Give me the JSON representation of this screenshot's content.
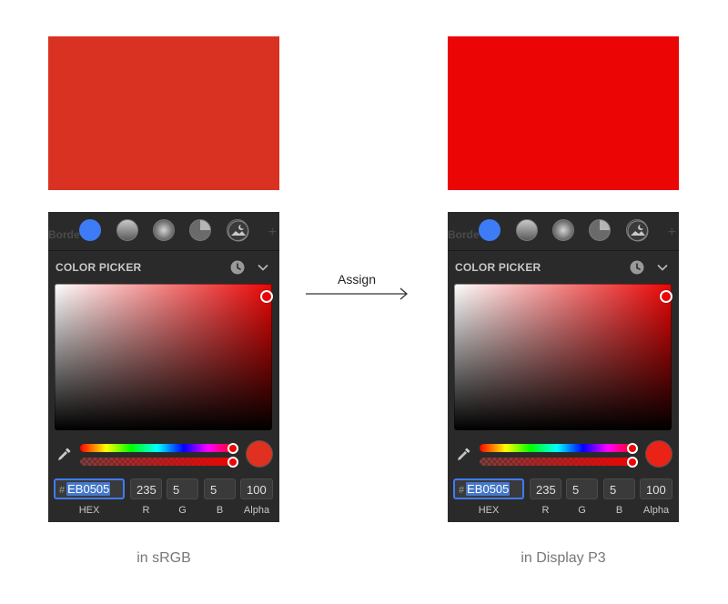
{
  "colors": {
    "srgb_swatch": "#D93223",
    "p3_swatch": "#EB0505",
    "accent": "#3D7CF6"
  },
  "arrow_label": "Assign",
  "panels": [
    {
      "id": "srgb",
      "caption": "in sRGB",
      "ghost_text": "Borde",
      "section_title": "COLOR PICKER",
      "hex_prefix": "#",
      "hex": "EB0505",
      "r": "235",
      "g": "5",
      "b": "5",
      "alpha": "100",
      "labels": {
        "hex": "HEX",
        "r": "R",
        "g": "G",
        "b": "B",
        "alpha": "Alpha"
      },
      "alpha_percent": 100,
      "icons": [
        "solid-fill-icon",
        "linear-gradient-icon",
        "radial-gradient-icon",
        "angular-gradient-icon",
        "image-fill-icon",
        "history-icon",
        "chevron-down-icon",
        "eyedropper-icon"
      ]
    },
    {
      "id": "p3",
      "caption": "in Display P3",
      "ghost_text": "Borde",
      "section_title": "COLOR PICKER",
      "hex_prefix": "#",
      "hex": "EB0505",
      "r": "235",
      "g": "5",
      "b": "5",
      "alpha": "100",
      "labels": {
        "hex": "HEX",
        "r": "R",
        "g": "G",
        "b": "B",
        "alpha": "Alpha"
      },
      "alpha_percent": 100,
      "icons": [
        "solid-fill-icon",
        "linear-gradient-icon",
        "radial-gradient-icon",
        "angular-gradient-icon",
        "image-fill-icon",
        "history-icon",
        "chevron-down-icon",
        "eyedropper-icon"
      ]
    }
  ]
}
